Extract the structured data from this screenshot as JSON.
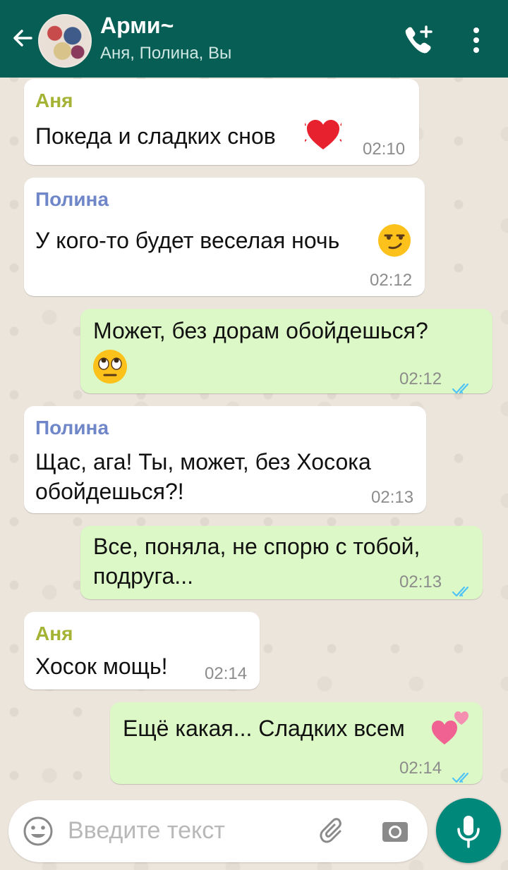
{
  "header": {
    "title": "Арми~",
    "subtitle": "Аня, Полина, Вы",
    "back_icon": "arrow-left-icon",
    "call_icon": "add-call-icon",
    "menu_icon": "more-vert-icon"
  },
  "messages": [
    {
      "sender": "Аня",
      "text": "Покеда и сладких снов",
      "emoji": "💓",
      "time": "02:10",
      "direction": "in"
    },
    {
      "sender": "Полина",
      "text": "У кого-то будет веселая ночь",
      "emoji": "😏",
      "time": "02:12",
      "direction": "in"
    },
    {
      "sender": "",
      "text": "Может, без дорам обойдешься?",
      "emoji": "🙄",
      "time": "02:12",
      "direction": "out",
      "read": true
    },
    {
      "sender": "Полина",
      "text_line1": "Щас, ага! Ты, может, без Хосока",
      "text_line2": "обойдешься?!",
      "time": "02:13",
      "direction": "in"
    },
    {
      "sender": "",
      "text_line1": "Все, поняла, не спорю с тобой,",
      "text_line2": "подруга...",
      "time": "02:13",
      "direction": "out",
      "read": true
    },
    {
      "sender": "Аня",
      "text": "Хосок мощь!",
      "time": "02:14",
      "direction": "in"
    },
    {
      "sender": "",
      "text": "Ещё какая... Сладких всем",
      "emoji": "💕",
      "time": "02:14",
      "direction": "out",
      "read": true
    }
  ],
  "input": {
    "placeholder": "Введите текст",
    "emoji_icon": "smiley-icon",
    "attach_icon": "paperclip-icon",
    "camera_icon": "camera-icon",
    "mic_icon": "microphone-icon"
  },
  "colors": {
    "header": "#075e54",
    "outgoing_bubble": "#dcf8c6",
    "incoming_bubble": "#ffffff",
    "mic_button": "#00897b",
    "read_ticks": "#4fc3f7"
  }
}
